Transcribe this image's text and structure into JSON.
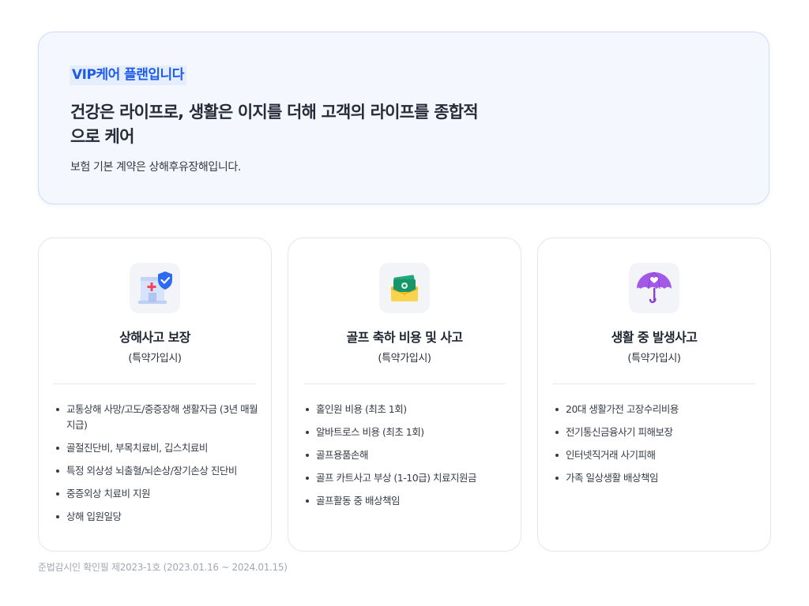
{
  "hero": {
    "badge": "VIP케어 플랜입니다",
    "headline": "건강은 라이프로, 생활은 이지를 더해 고객의 라이프를 종합적으로 케어",
    "description": "보험 기본 계약은 상해후유장해입니다."
  },
  "cards": [
    {
      "icon": "hospital-shield-icon",
      "title": "상해사고 보장",
      "subtitle": "(특약가입시)",
      "items": [
        "교통상해 사망/고도/중증장해 생활자금 (3년 매월지급)",
        "골절진단비, 부목치료비, 깁스치료비",
        "특정 외상성 뇌출혈/뇌손상/장기손상 진단비",
        "중증외상 치료비 지원",
        "상해 입원일당"
      ]
    },
    {
      "icon": "money-envelope-icon",
      "title": "골프 축하 비용 및 사고",
      "subtitle": "(특약가입시)",
      "items": [
        "홀인원 비용 (최초 1회)",
        "알바트로스 비용 (최초 1회)",
        "골프용품손해",
        "골프 카트사고 부상 (1-10급) 치료지원금",
        "골프활동 중 배상책임"
      ]
    },
    {
      "icon": "umbrella-heart-icon",
      "title": "생활 중 발생사고",
      "subtitle": "(특약가입시)",
      "items": [
        "20대 생활가전 고장수리비용",
        "전기통신금융사기 피해보장",
        "인터넷직거래 사기피해",
        "가족 일상생활 배상책임"
      ]
    }
  ],
  "footer": {
    "note": "준법감시인 확인필 제2023-1호 (2023.01.16 ~ 2024.01.15)"
  },
  "colors": {
    "accent": "#1c5ce8",
    "hero_bg": "#f4f7fe",
    "hero_border": "#cfdcfb",
    "card_border": "#e3e6ea",
    "muted_text": "#a2a8b1"
  }
}
